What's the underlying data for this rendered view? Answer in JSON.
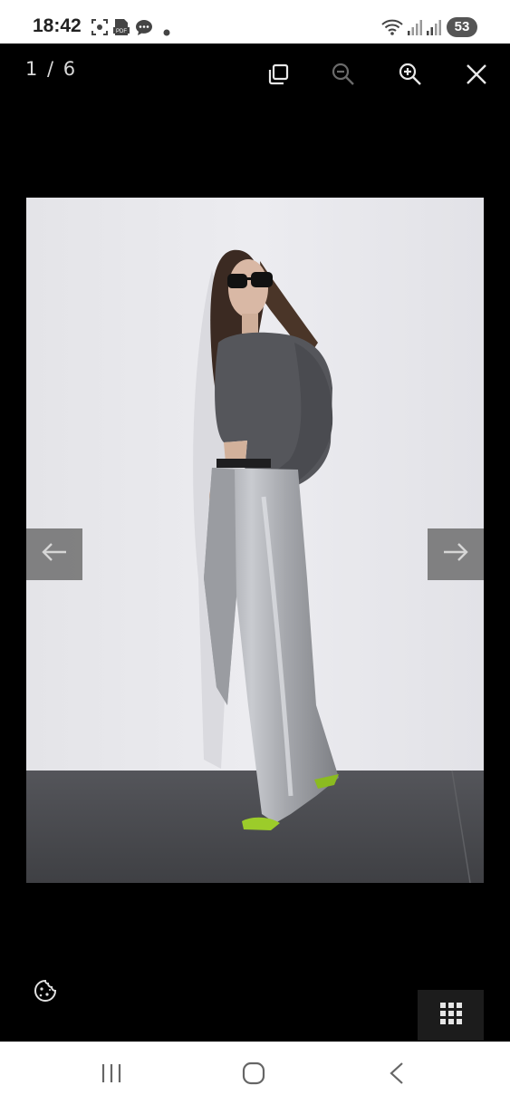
{
  "status_bar": {
    "time": "18:42",
    "battery": "53",
    "icons": [
      "screenshot-icon",
      "pdf-icon",
      "messages-icon",
      "notification-dot-icon",
      "wifi-icon",
      "signal-icon",
      "signal-icon-2"
    ]
  },
  "viewer": {
    "counter": "1 / 6",
    "tools": [
      "duplicate-icon",
      "zoom-out-icon",
      "zoom-in-icon",
      "close-icon"
    ],
    "photo_alt": "Model wearing a grey cropped sweater and metallic silver wide-leg jeans",
    "prev_icon": "arrow-left-icon",
    "next_icon": "arrow-right-icon",
    "cookie_icon": "cookie-icon",
    "grid_icon": "grid-icon"
  },
  "nav_bar": {
    "buttons": [
      "recents-icon",
      "home-icon",
      "back-icon"
    ]
  },
  "colors": {
    "status_bg": "#ffffff",
    "viewer_bg": "#000000",
    "arrow_bg": "#6e6e6e",
    "wall": "#e6e6ea",
    "floor": "#4a4b4e"
  }
}
